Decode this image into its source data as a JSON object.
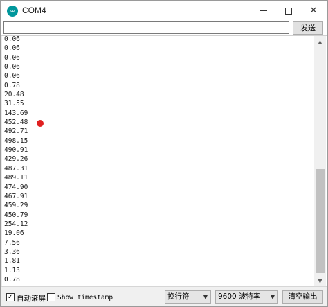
{
  "window": {
    "title": "COM4",
    "icon_name": "arduino-icon",
    "icon_text": "∞"
  },
  "send": {
    "input_value": "",
    "button_label": "发送"
  },
  "output": {
    "lines": [
      "0.06",
      "0.06",
      "0.06",
      "0.06",
      "0.06",
      "0.78",
      "20.48",
      "31.55",
      "143.69",
      "452.48",
      "492.71",
      "498.15",
      "490.91",
      "429.26",
      "487.31",
      "489.11",
      "474.90",
      "467.91",
      "459.29",
      "450.79",
      "254.12",
      "19.06",
      "7.56",
      "3.36",
      "1.81",
      "1.13",
      "0.78"
    ],
    "marker_color": "#e02020"
  },
  "footer": {
    "autoscroll_label": "自动滚屏",
    "autoscroll_checked": true,
    "timestamp_label": "Show timestamp",
    "timestamp_checked": false,
    "line_ending_selected": "换行符",
    "baud_selected": "9600 波特率",
    "clear_button_label": "清空输出"
  },
  "colors": {
    "accent": "#00979c"
  }
}
